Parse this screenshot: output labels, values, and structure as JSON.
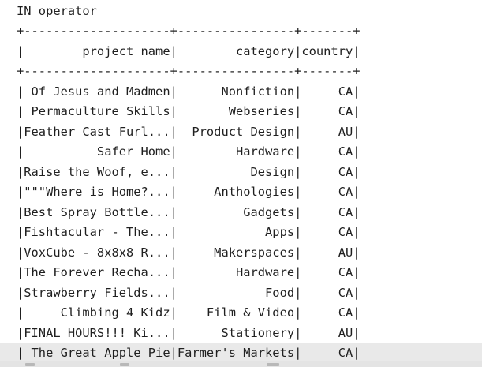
{
  "console": {
    "heading": "IN operator",
    "separator": "+--------------------+----------------+-------+",
    "header_row": "|        project_name|        category|country|",
    "rows": [
      "| Of Jesus and Madmen|      Nonfiction|     CA|",
      "| Permaculture Skills|       Webseries|     CA|",
      "|Feather Cast Furl...|  Product Design|     AU|",
      "|          Safer Home|        Hardware|     CA|",
      "|Raise the Woof, e...|          Design|     CA|",
      "|\"\"\"Where is Home?...|     Anthologies|     CA|",
      "|Best Spray Bottle...|         Gadgets|     CA|",
      "|Fishtacular - The...|            Apps|     CA|",
      "|VoxCube - 8x8x8 R...|     Makerspaces|     AU|",
      "|The Forever Recha...|        Hardware|     CA|",
      "|Strawberry Fields...|            Food|     CA|",
      "|     Climbing 4 Kidz|    Film & Video|     CA|",
      "|FINAL HOURS!!! Ki...|      Stationery|     AU|",
      "| The Great Apple Pie|Farmer's Markets|     CA|"
    ]
  }
}
